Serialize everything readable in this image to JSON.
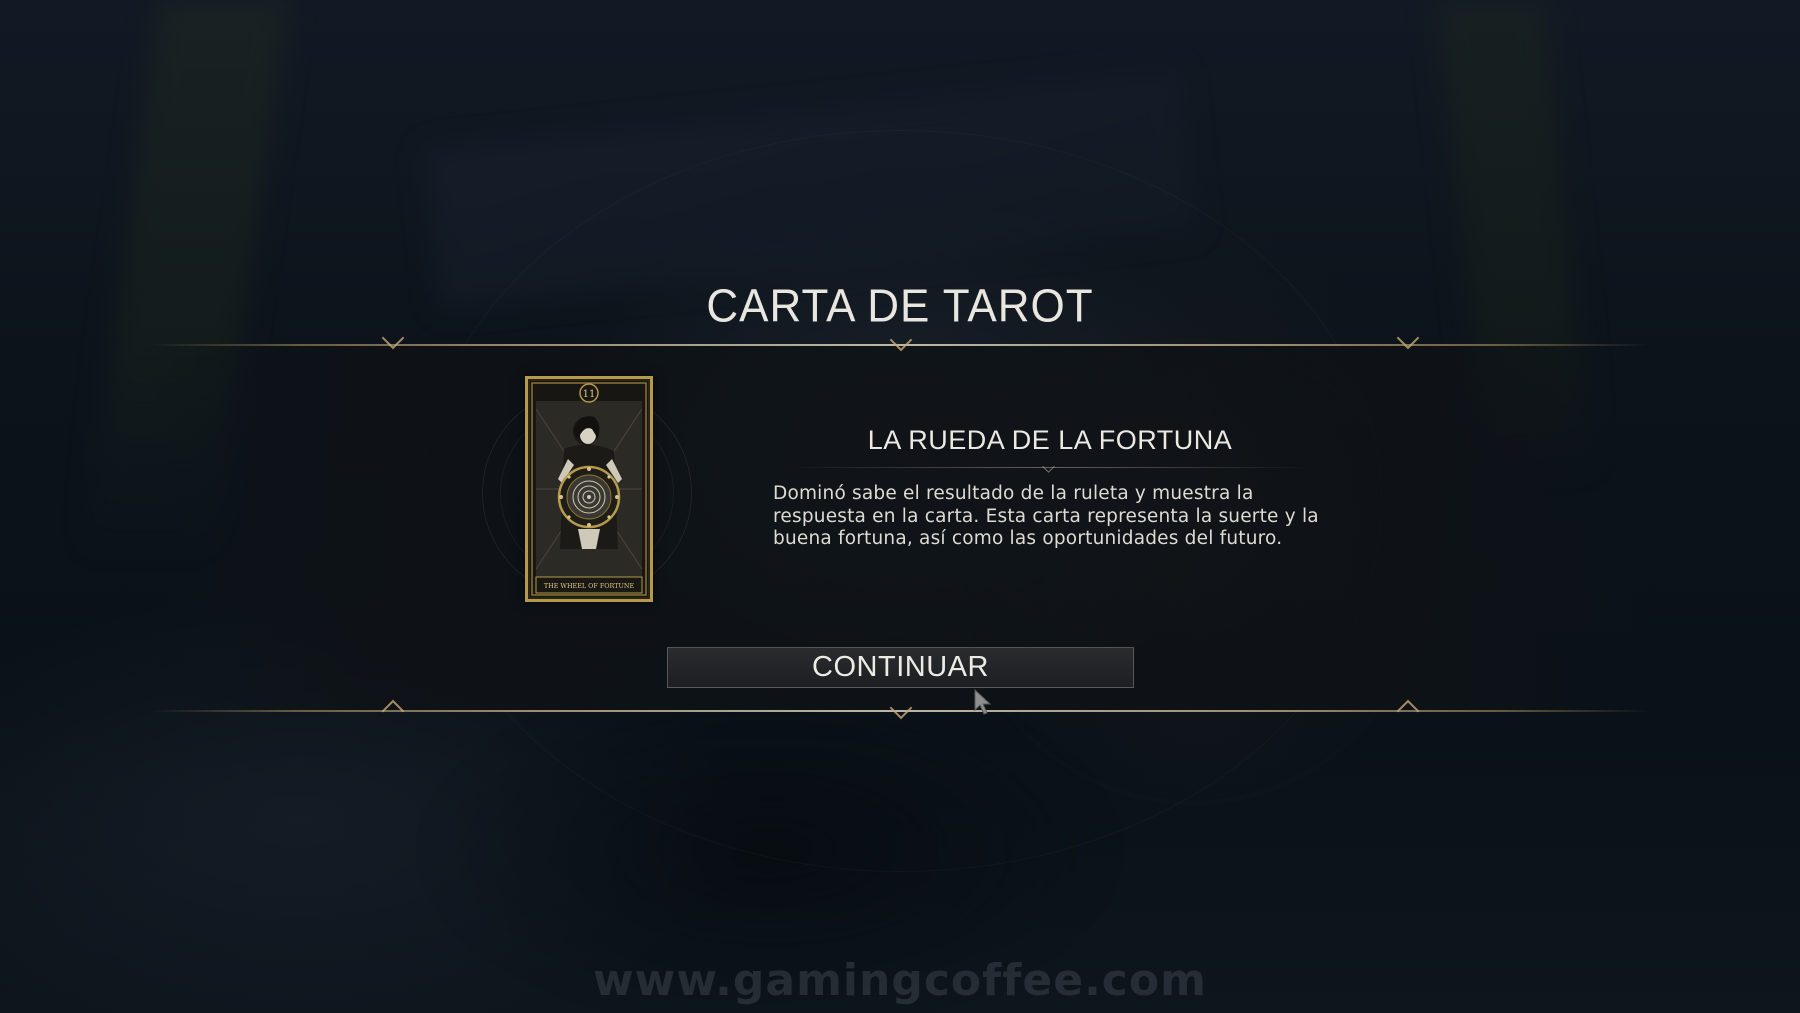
{
  "screen": {
    "title": "CARTA DE TAROT"
  },
  "card": {
    "number": "11",
    "footer_label": "THE WHEEL OF FORTUNE",
    "name": "LA RUEDA DE LA FORTUNA",
    "description": "Dominó sabe el resultado de la ruleta y muestra la respuesta en la carta. Esta carta representa la suerte y la buena fortuna, así como las oportunidades del futuro.",
    "frame_color": "#b59a4c"
  },
  "actions": {
    "continue_label": "CONTINUAR"
  },
  "watermark": {
    "text": "www.gamingcoffee.com"
  },
  "colors": {
    "accent_gold": "#c8aa78",
    "text_primary": "#ece9e2"
  }
}
